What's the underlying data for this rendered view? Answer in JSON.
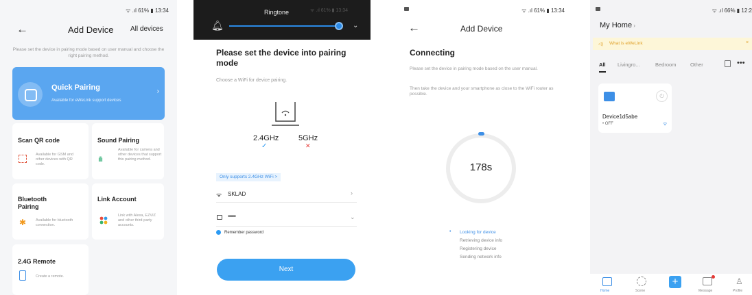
{
  "screen1": {
    "status": "ᯤ .ıl 61% ▮ 13:34",
    "title": "Add Device",
    "right_action": "All devices",
    "subtitle": "Please set the device in pairing mode based on user manual and choose the right pairing method.",
    "quick_pairing": {
      "title": "Quick Pairing",
      "desc": "Available for eWeLink support devices"
    },
    "scan_qr": {
      "title": "Scan QR code",
      "desc": "Available for GSM and other devices with QR code."
    },
    "sound_pairing": {
      "title": "Sound Pairing",
      "desc": "Available for camera and other devices that support this pairing method."
    },
    "bluetooth": {
      "title": "Bluetooth Pairing",
      "desc": "Available for bluetooth connection."
    },
    "link_account": {
      "title": "Link Account",
      "desc": "Link with Alexa, EZVIZ and other third-party accounts."
    },
    "remote": {
      "title": "2.4G Remote",
      "desc": "Create a remote."
    }
  },
  "screen2": {
    "ringtone_label": "Ringtone",
    "status": "ᯤ .ıl 61% ▮ 13:34",
    "heading": "Please set the device into pairing mode",
    "subheading": "Choose a WiFi for device pairing.",
    "band_24": "2.4GHz",
    "band_5": "5GHz",
    "support_note": "Only supports 2.4GHz WiFi >",
    "wifi_name": "SKLAD",
    "password_mask": "••••••••••",
    "remember": "Remember password",
    "next_button": "Next"
  },
  "screen3": {
    "status": "ᯤ .ıl 61% ▮ 13:34",
    "title": "Add Device",
    "heading": "Connecting",
    "p1": "Please set the device in pairing mode based on the user manual.",
    "p2": "Then take the device and your smartphone as close to the WiFi router as possible.",
    "countdown": "178s",
    "steps": [
      "Looking for device",
      "Retrieving device info",
      "Registering device",
      "Sending network info"
    ]
  },
  "screen4": {
    "status": "ᯤ .ıl 66% ▮ 12:2",
    "home": "My Home",
    "banner": "What is eWeLink",
    "tabs": [
      "All",
      "Livingro...",
      "Bedroom",
      "Other"
    ],
    "device_name": "Device1d5abe",
    "device_state": "• OFF",
    "nav": [
      "Home",
      "Scene",
      "",
      "Message",
      "Profile"
    ]
  },
  "colors": {
    "accent": "#3ba1f1",
    "quick_pairing": "#5aa6f0",
    "error": "#e53935",
    "success": "#2b9af3"
  }
}
